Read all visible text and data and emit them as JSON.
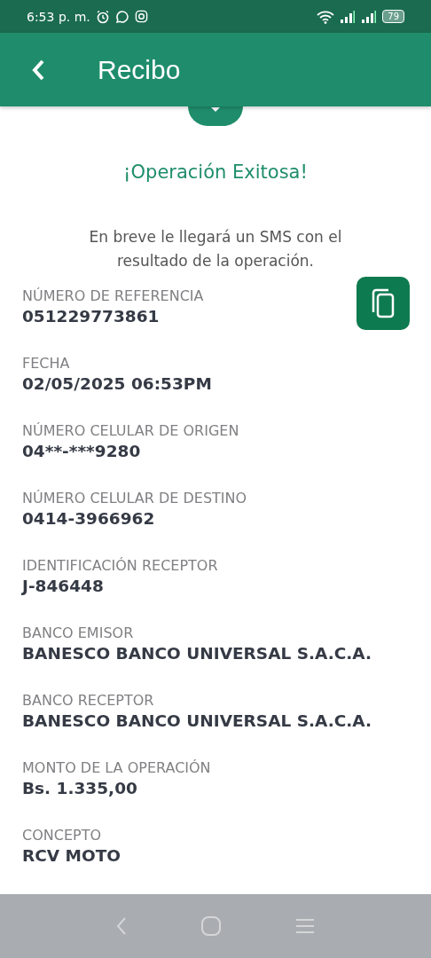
{
  "status_bar": {
    "time": "6:53 p. m.",
    "battery": "79"
  },
  "header": {
    "title": "Recibo"
  },
  "result": {
    "title": "¡Operación Exitosa!",
    "message": "En breve le llegará un SMS con el resultado de la operación."
  },
  "fields": [
    {
      "label": "NÚMERO DE REFERENCIA",
      "value": "051229773861",
      "copyable": true
    },
    {
      "label": "FECHA",
      "value": "02/05/2025 06:53PM",
      "copyable": false
    },
    {
      "label": "NÚMERO CELULAR DE ORIGEN",
      "value": "04**-***9280",
      "copyable": false
    },
    {
      "label": "NÚMERO CELULAR DE DESTINO",
      "value": "0414-3966962",
      "copyable": false
    },
    {
      "label": "IDENTIFICACIÓN RECEPTOR",
      "value": "J-846448",
      "copyable": false
    },
    {
      "label": "BANCO EMISOR",
      "value": "BANESCO BANCO UNIVERSAL S.A.C.A.",
      "copyable": false
    },
    {
      "label": "BANCO RECEPTOR",
      "value": "BANESCO BANCO UNIVERSAL S.A.C.A.",
      "copyable": false
    },
    {
      "label": "MONTO DE LA OPERACIÓN",
      "value": "Bs. 1.335,00",
      "copyable": false
    },
    {
      "label": "CONCEPTO",
      "value": "RCV MOTO",
      "copyable": false
    }
  ]
}
